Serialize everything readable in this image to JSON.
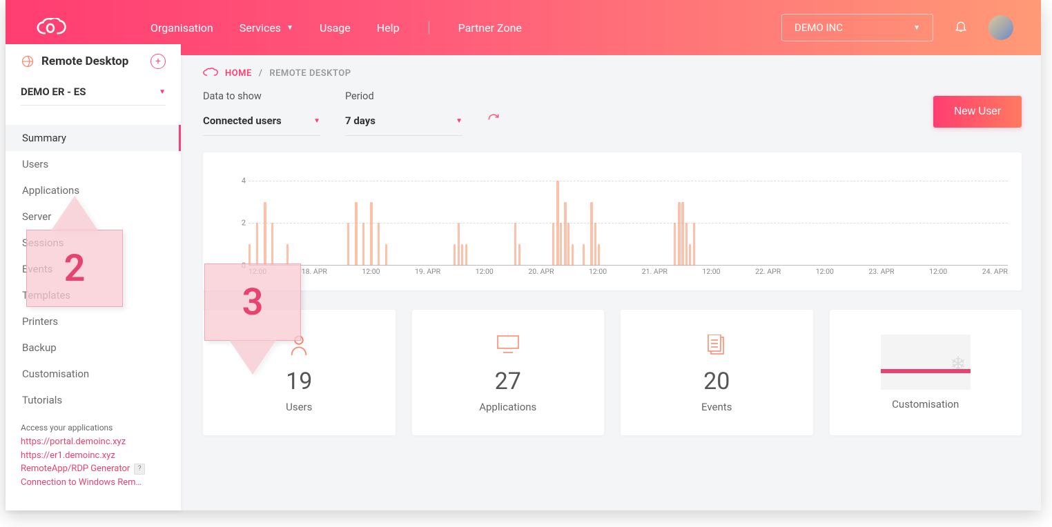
{
  "header": {
    "nav": {
      "organisation": "Organisation",
      "services": "Services",
      "usage": "Usage",
      "help": "Help",
      "partner": "Partner Zone"
    },
    "org_selected": "DEMO INC"
  },
  "sidebar": {
    "product_title": "Remote Desktop",
    "environment_selected": "DEMO ER - ES",
    "items": [
      "Summary",
      "Users",
      "Applications",
      "Server",
      "Sessions",
      "Events",
      "Templates",
      "Printers",
      "Backup",
      "Customisation",
      "Tutorials"
    ],
    "active_index": 0,
    "footer_label": "Access your applications",
    "links": [
      "https://portal.demoinc.xyz",
      "https://er1.demoinc.xyz",
      "RemoteApp/RDP Generator",
      "Connection to Windows Rem…"
    ]
  },
  "breadcrumb": {
    "home": "HOME",
    "current": "REMOTE DESKTOP"
  },
  "filters": {
    "data_label": "Data to show",
    "data_value": "Connected users",
    "period_label": "Period",
    "period_value": "7 days"
  },
  "actions": {
    "new_user": "New User"
  },
  "chart_data": {
    "type": "area",
    "title": "",
    "xlabel": "",
    "ylabel": "",
    "ylim": [
      0,
      5
    ],
    "yticks": [
      0,
      2,
      4
    ],
    "x_ticks": [
      "12:00",
      "18. APR",
      "12:00",
      "19. APR",
      "12:00",
      "20. APR",
      "12:00",
      "21. APR",
      "12:00",
      "22. APR",
      "12:00",
      "23. APR",
      "12:00",
      "24. APR"
    ],
    "series": [
      {
        "name": "Connected users",
        "x": [
          0.0,
          0.01,
          0.02,
          0.03,
          0.05,
          0.13,
          0.14,
          0.15,
          0.16,
          0.17,
          0.18,
          0.27,
          0.275,
          0.28,
          0.285,
          0.35,
          0.355,
          0.4,
          0.405,
          0.41,
          0.415,
          0.42,
          0.425,
          0.44,
          0.45,
          0.455,
          0.46,
          0.56,
          0.565,
          0.57,
          0.575,
          0.58,
          0.585,
          0.6
        ],
        "y": [
          1,
          2,
          3,
          2,
          1,
          2,
          3,
          2,
          3,
          2,
          1,
          1,
          2,
          1,
          1,
          2,
          1,
          2,
          4,
          2,
          3,
          2,
          1,
          1,
          3,
          2,
          1,
          2,
          3,
          3,
          2,
          1,
          2,
          0
        ]
      }
    ]
  },
  "stats": {
    "users": {
      "value": "19",
      "label": "Users"
    },
    "apps": {
      "value": "27",
      "label": "Applications"
    },
    "events": {
      "value": "20",
      "label": "Events"
    },
    "custom": {
      "label": "Customisation"
    }
  },
  "annotations": {
    "callout2": "2",
    "callout3": "3"
  }
}
